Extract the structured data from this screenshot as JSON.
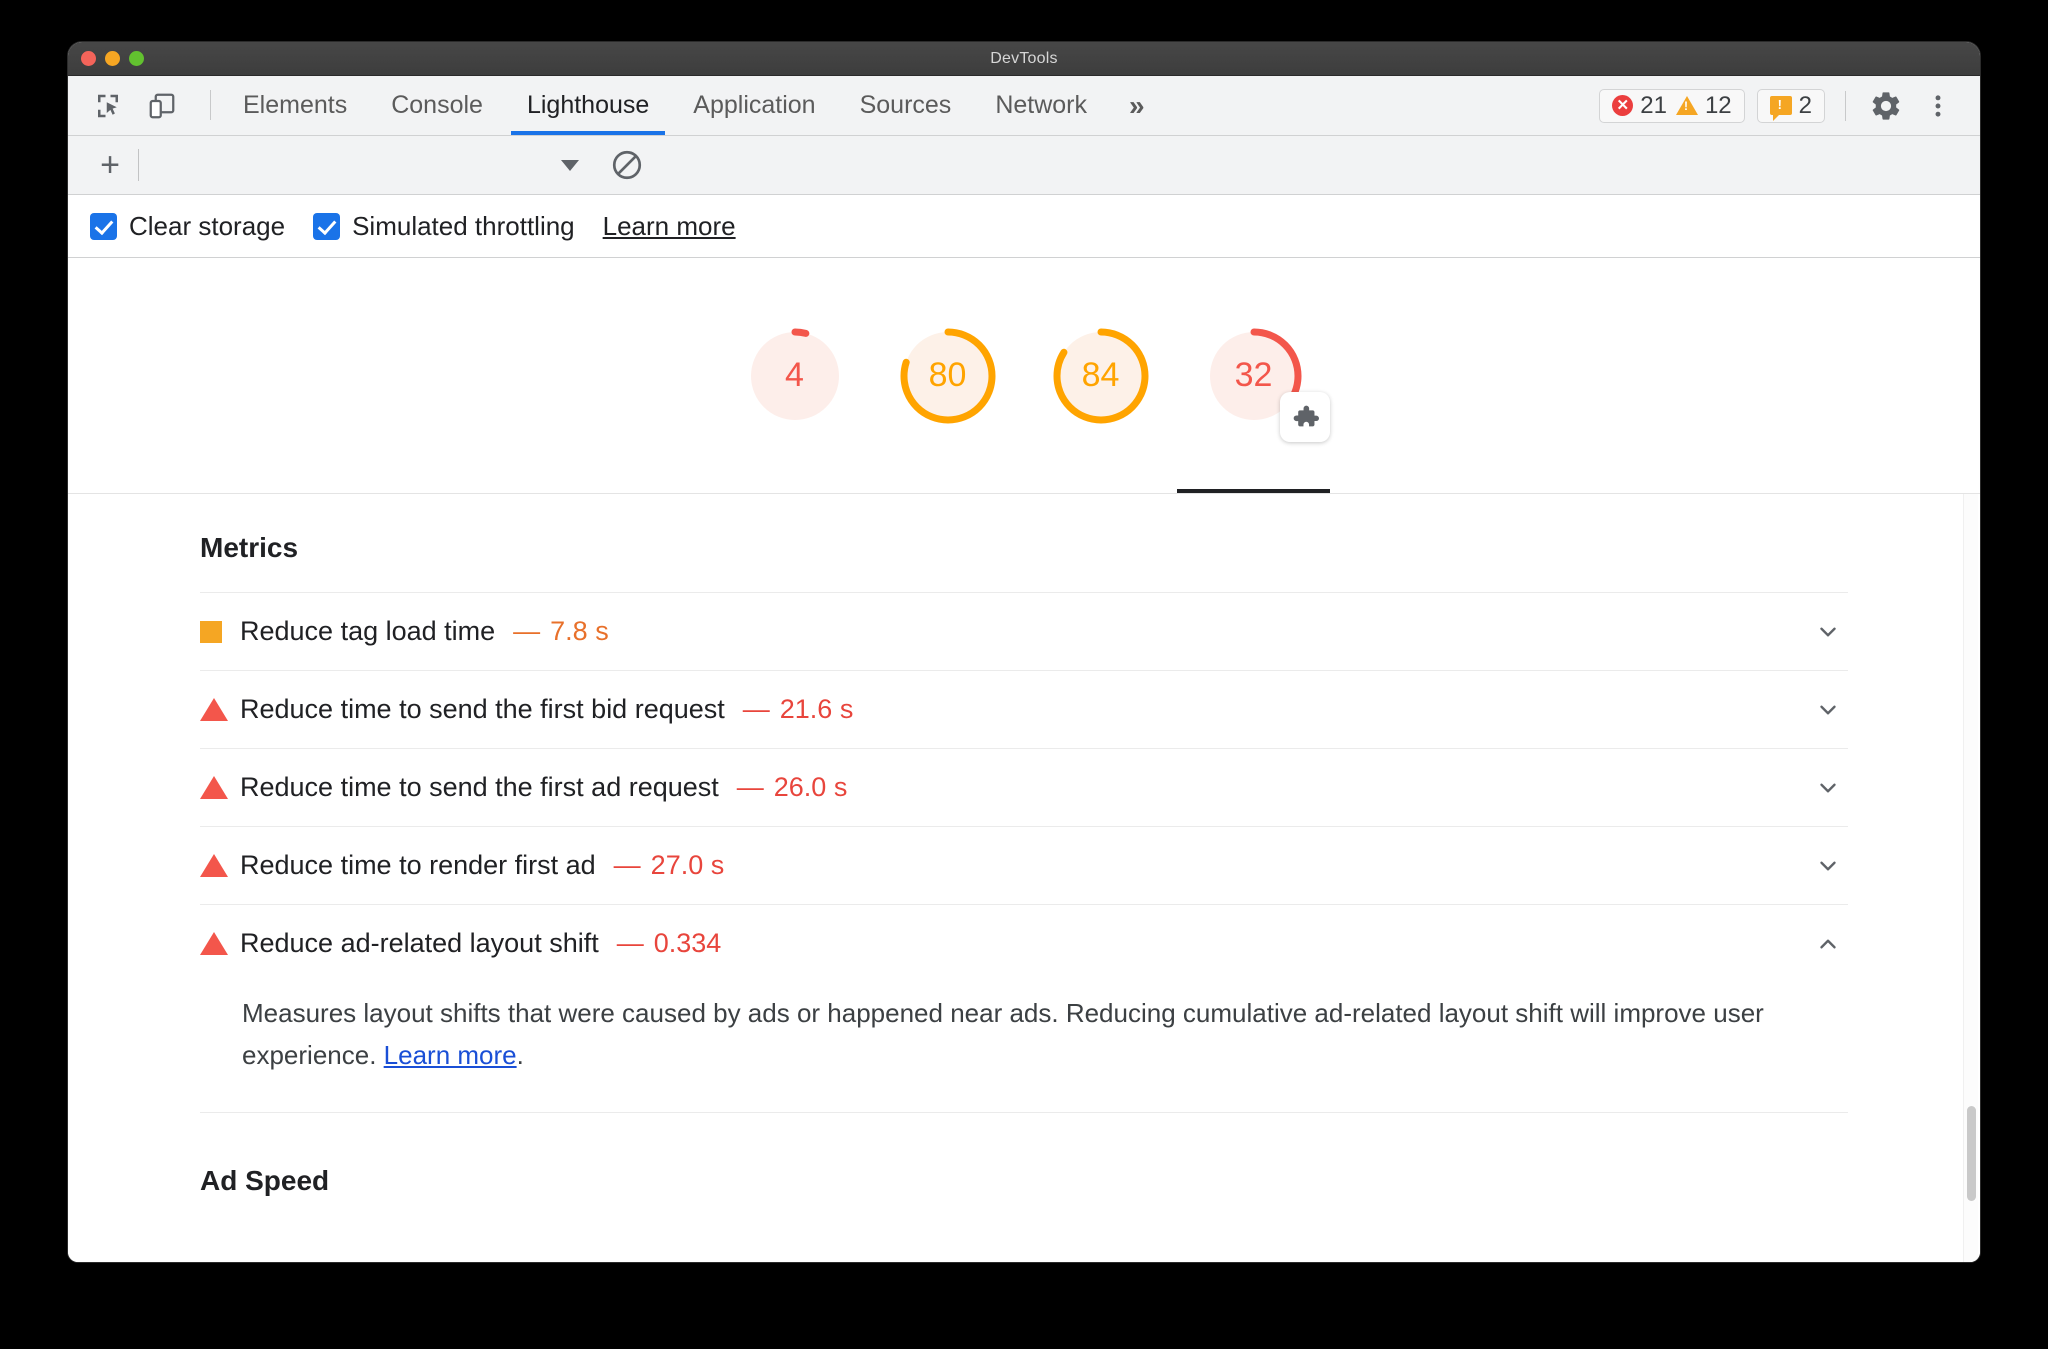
{
  "window": {
    "title": "DevTools",
    "traffic_lights": [
      "close-red",
      "minimize-yellow",
      "maximize-green"
    ]
  },
  "toolbar": {
    "inspect_icon": "inspect-element-icon",
    "device_icon": "device-toolbar-icon",
    "tabs": [
      {
        "label": "Elements",
        "active": false
      },
      {
        "label": "Console",
        "active": false
      },
      {
        "label": "Lighthouse",
        "active": true
      },
      {
        "label": "Application",
        "active": false
      },
      {
        "label": "Sources",
        "active": false
      },
      {
        "label": "Network",
        "active": false
      }
    ],
    "more_tabs_label": "»",
    "counters": {
      "errors": "21",
      "warnings": "12",
      "issues": "2"
    },
    "settings_icon": "gear-icon",
    "menu_icon": "kebab-menu-icon",
    "colors": {
      "error": "#eb3e3e",
      "warning": "#f5a623",
      "info": "#f5a623",
      "active_tab_underline": "#1a73e8"
    }
  },
  "subtoolbar": {
    "add_label": "+",
    "dropdown_icon": "chevron-down-icon",
    "clear_icon": "clear-no-entry-icon"
  },
  "options": {
    "checkboxes": [
      {
        "label": "Clear storage",
        "checked": true
      },
      {
        "label": "Simulated throttling",
        "checked": true
      }
    ],
    "learn_more_label": "Learn more"
  },
  "report": {
    "gauges": [
      {
        "score": "4",
        "color": "#f3564b",
        "percent": 4,
        "selected": false,
        "badge": null
      },
      {
        "score": "80",
        "color": "#ffa400",
        "percent": 80,
        "selected": false,
        "badge": null
      },
      {
        "score": "84",
        "color": "#ffa400",
        "percent": 84,
        "selected": false,
        "badge": null
      },
      {
        "score": "32",
        "color": "#f3564b",
        "percent": 32,
        "selected": true,
        "badge": "puzzle-piece-icon"
      }
    ],
    "metrics_heading": "Metrics",
    "metrics": [
      {
        "severity": "square",
        "severity_color": "#f5a623",
        "title": "Reduce tag load time",
        "dash": "—",
        "value": "7.8 s",
        "value_color": "#e8702a",
        "expanded": false,
        "chevron": "chevron-down-icon"
      },
      {
        "severity": "triangle",
        "severity_color": "#f3564b",
        "title": "Reduce time to send the first bid request",
        "dash": "—",
        "value": "21.6 s",
        "value_color": "#e8453c",
        "expanded": false,
        "chevron": "chevron-down-icon"
      },
      {
        "severity": "triangle",
        "severity_color": "#f3564b",
        "title": "Reduce time to send the first ad request",
        "dash": "—",
        "value": "26.0 s",
        "value_color": "#e8453c",
        "expanded": false,
        "chevron": "chevron-down-icon"
      },
      {
        "severity": "triangle",
        "severity_color": "#f3564b",
        "title": "Reduce time to render first ad",
        "dash": "—",
        "value": "27.0 s",
        "value_color": "#e8453c",
        "expanded": false,
        "chevron": "chevron-down-icon"
      },
      {
        "severity": "triangle",
        "severity_color": "#f3564b",
        "title": "Reduce ad-related layout shift",
        "dash": "—",
        "value": "0.334",
        "value_color": "#e8453c",
        "expanded": true,
        "chevron": "chevron-up-icon"
      }
    ],
    "expanded_description": {
      "text_before_link": "Measures layout shifts that were caused by ads or happened near ads. Reducing cumulative ad-related layout shift will improve user experience. ",
      "link_label": "Learn more",
      "text_after_link": "."
    },
    "next_section_heading": "Ad Speed"
  }
}
